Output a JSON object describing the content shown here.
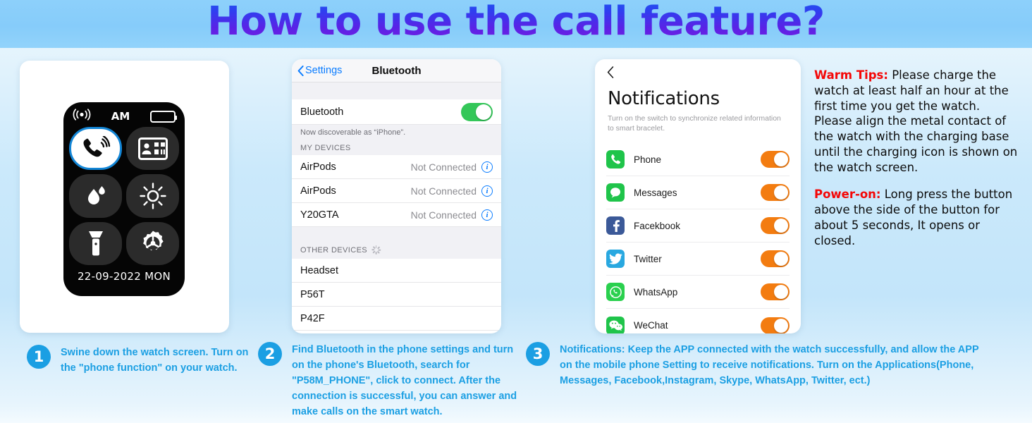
{
  "header": {
    "title": "How to use the call feature?"
  },
  "watch": {
    "status": {
      "signal_icon": "signal-waves-icon",
      "meridiem": "AM",
      "battery_icon": "battery-icon"
    },
    "tiles": [
      {
        "name": "phone-call",
        "icon": "phone-call-icon",
        "active": true
      },
      {
        "name": "contacts",
        "icon": "contact-card-icon",
        "active": false
      },
      {
        "name": "water-lock",
        "icon": "water-drop-icon",
        "active": false
      },
      {
        "name": "brightness",
        "icon": "brightness-sun-icon",
        "active": false
      },
      {
        "name": "flashlight",
        "icon": "flashlight-icon",
        "active": false
      },
      {
        "name": "settings",
        "icon": "settings-gear-icon",
        "active": false
      }
    ],
    "date": "22-09-2022  MON"
  },
  "bluetooth": {
    "back_label": "Settings",
    "nav_title": "Bluetooth",
    "toggle_row_label": "Bluetooth",
    "toggle_on": true,
    "discoverable_note": "Now discoverable as “iPhone”.",
    "my_devices_header": "MY DEVICES",
    "my_devices": [
      {
        "name": "AirPods",
        "state": "Not Connected"
      },
      {
        "name": "AirPods",
        "state": "Not Connected"
      },
      {
        "name": "Y20GTA",
        "state": "Not Connected"
      }
    ],
    "other_devices_header": "OTHER DEVICES",
    "other_devices": [
      {
        "name": "Headset"
      },
      {
        "name": "P56T"
      },
      {
        "name": "P42F"
      }
    ]
  },
  "notifications": {
    "back_icon": "chevron-left-icon",
    "title": "Notifications",
    "subtitle": "Turn on the switch to synchronize related information to smart bracelet.",
    "apps": [
      {
        "label": "Phone",
        "icon": "phone-app-icon",
        "icon_bg": "#1fc44a",
        "on": true
      },
      {
        "label": "Messages",
        "icon": "messages-app-icon",
        "icon_bg": "#1fc44a",
        "on": true
      },
      {
        "label": "Facekbook",
        "icon": "facebook-app-icon",
        "icon_bg": "#3b5998",
        "on": true
      },
      {
        "label": "Twitter",
        "icon": "twitter-app-icon",
        "icon_bg": "#29a8e0",
        "on": true
      },
      {
        "label": "WhatsApp",
        "icon": "whatsapp-app-icon",
        "icon_bg": "#2ad04e",
        "on": true
      },
      {
        "label": "WeChat",
        "icon": "wechat-app-icon",
        "icon_bg": "#1fc44a",
        "on": true
      }
    ]
  },
  "tips": {
    "warm_label": "Warm Tips:",
    "warm_text": " Please charge the watch at least half an hour at the first time you get the watch. Please align the metal contact of the watch with the charging base until the charging icon is shown on the watch screen.",
    "power_label": "Power-on:",
    "power_text": " Long press the button above the side of the button for about 5 seconds, It opens or closed."
  },
  "captions": [
    {
      "number": "1",
      "text": "Swine down the watch screen. Turn on the \"phone function\" on your watch."
    },
    {
      "number": "2",
      "text": "Find Bluetooth in the phone settings and turn on the phone's Bluetooth, search for \"P58M_PHONE\", click to connect. After the connection is successful, you can answer and make calls on the smart watch."
    },
    {
      "number": "3",
      "text": "Notifications: Keep the APP connected with the watch successfully, and allow the APP on the mobile phone Setting to receive notifications. Turn on the Applications(Phone, Messages, Facebook,Instagram, Skype, WhatsApp, Twitter, ect.)"
    }
  ],
  "colors": {
    "accent_blue": "#1b9fe3",
    "toggle_green": "#34c759",
    "toggle_orange": "#f37c10",
    "tip_red": "#f40707"
  }
}
